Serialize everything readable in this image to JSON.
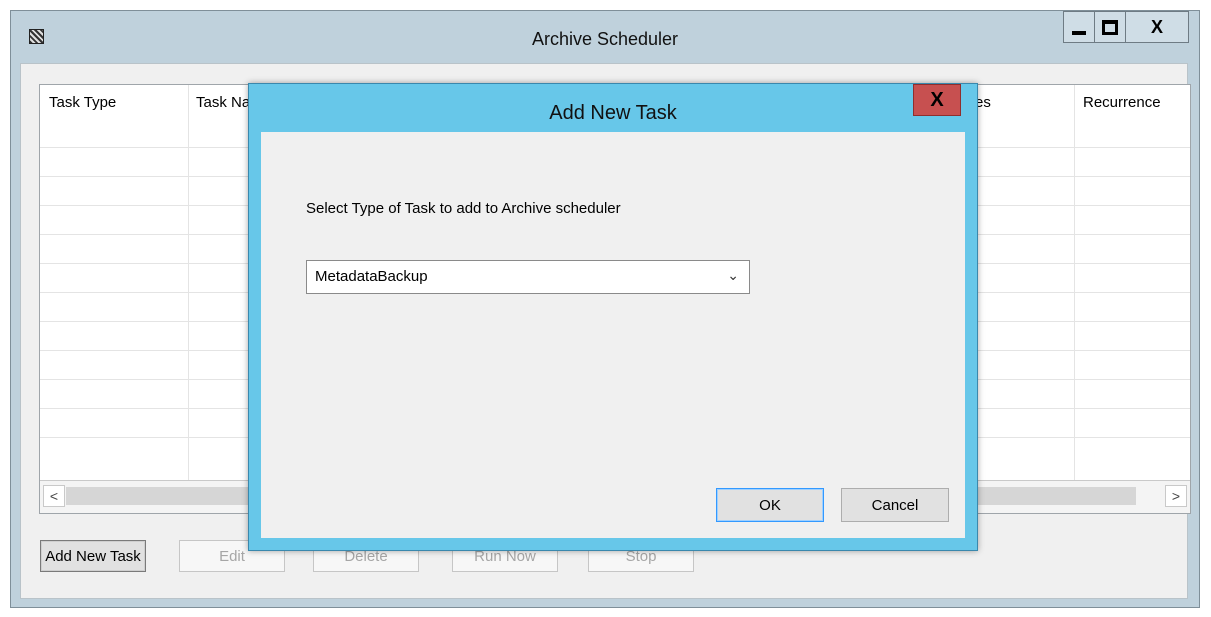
{
  "window": {
    "title": "Archive Scheduler",
    "close_label": "X"
  },
  "grid": {
    "columns": [
      "Task Type",
      "Task Na",
      "es",
      "Recurrence"
    ],
    "row_count": 11
  },
  "scrollbar": {
    "left_arrow": "<",
    "right_arrow": ">"
  },
  "toolbar": {
    "add_label": "Add New Task",
    "edit_label": "Edit",
    "delete_label": "Delete",
    "run_label": "Run Now",
    "stop_label": "Stop"
  },
  "dialog": {
    "title": "Add New Task",
    "close_label": "X",
    "prompt": "Select Type of Task to add to Archive scheduler",
    "task_type_value": "MetadataBackup",
    "ok_label": "OK",
    "cancel_label": "Cancel"
  },
  "colors": {
    "dialog_frame": "#67c7e9",
    "close_button": "#c75050",
    "window_frame": "#bfd1dc"
  }
}
